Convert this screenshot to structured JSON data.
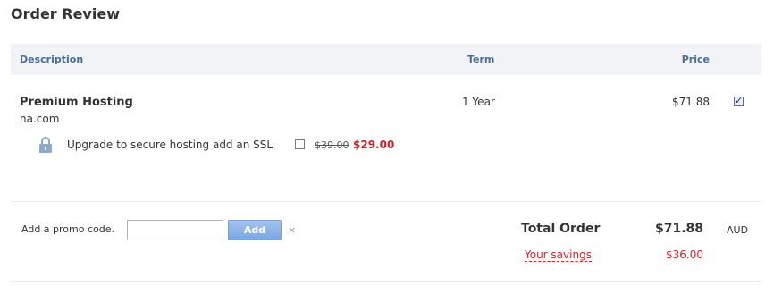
{
  "page": {
    "title": "Order Review"
  },
  "table": {
    "headers": {
      "description": "Description",
      "term": "Term",
      "price": "Price"
    }
  },
  "item": {
    "name": "Premium Hosting",
    "domain": "na.com",
    "term": "1 Year",
    "price": "$71.88",
    "selected": true
  },
  "upsell": {
    "icon": "lock-icon",
    "text": "Upgrade to secure hosting add an SSL",
    "selected": false,
    "old_price": "$39.00",
    "new_price": "$29.00"
  },
  "promo": {
    "label": "Add a promo code.",
    "input_value": "",
    "add_label": "Add",
    "clear_label": "×"
  },
  "totals": {
    "total_label": "Total Order",
    "total_value": "$71.88",
    "currency": "AUD",
    "savings_label": "Your savings",
    "savings_value": "$36.00"
  },
  "colors": {
    "header_text": "#4a6d94",
    "header_bg": "#f1f3f6",
    "sale_red": "#d0202a",
    "button_blue": "#7aa6e0"
  }
}
